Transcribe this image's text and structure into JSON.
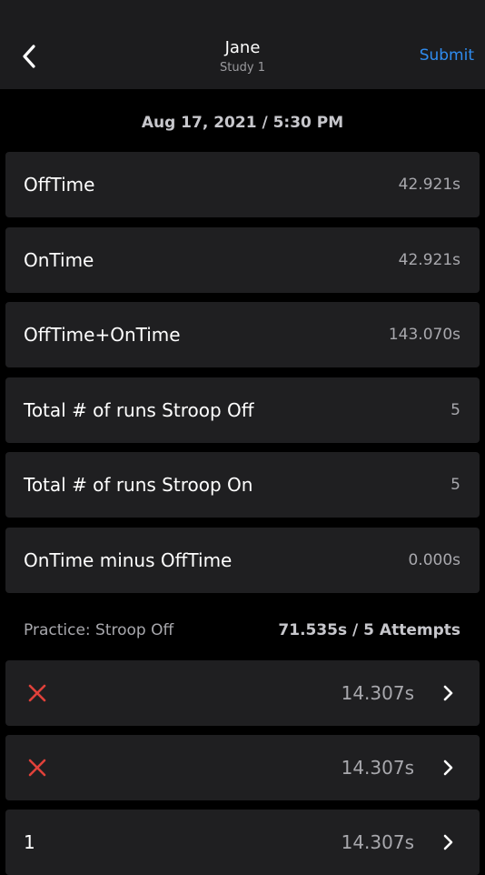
{
  "header": {
    "title": "Jane",
    "subtitle": "Study 1",
    "submit_label": "Submit"
  },
  "session": {
    "datetime": "Aug 17, 2021 / 5:30 PM"
  },
  "stats": [
    {
      "label": "OffTime",
      "value": "42.921s"
    },
    {
      "label": "OnTime",
      "value": "42.921s"
    },
    {
      "label": "OffTime+OnTime",
      "value": "143.070s"
    },
    {
      "label": "Total # of runs Stroop Off",
      "value": "5"
    },
    {
      "label": "Total # of runs Stroop On",
      "value": "5"
    },
    {
      "label": "OnTime minus OffTime",
      "value": "0.000s"
    }
  ],
  "practice": {
    "label": "Practice: Stroop Off",
    "summary": "71.535s / 5 Attempts",
    "attempts": [
      {
        "mark": "x",
        "time": "14.307s"
      },
      {
        "mark": "x",
        "time": "14.307s"
      },
      {
        "mark": "1",
        "time": "14.307s"
      }
    ]
  },
  "colors": {
    "accent": "#2f8cf0",
    "error": "#e0413a",
    "card": "#1f1f21",
    "background": "#000000"
  },
  "icons": {
    "back": "chevron-left-icon",
    "fail": "close-icon",
    "disclosure": "chevron-right-icon"
  }
}
